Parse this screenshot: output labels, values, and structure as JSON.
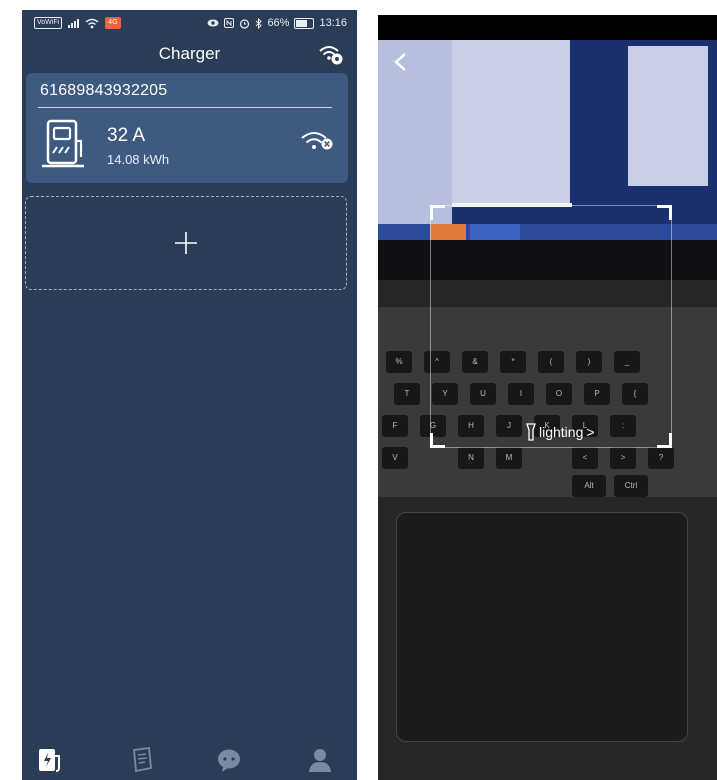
{
  "status_bar": {
    "left_chips": [
      "VoWiFi",
      "4G"
    ],
    "icons": [
      "eye-icon",
      "nfc-icon",
      "alarm-icon",
      "bluetooth-icon"
    ],
    "battery": "66%",
    "time": "13:16"
  },
  "header": {
    "title": "Charger",
    "action_icon": "wifi-settings-icon"
  },
  "charger_card": {
    "device_id": "61689843932205",
    "current": "32 A",
    "energy": "14.08 kWh",
    "icon": "charging-station-icon",
    "status_icon": "wifi-disconnected-icon"
  },
  "add_device": {
    "icon": "plus-icon"
  },
  "tab_bar": {
    "tabs": [
      {
        "name": "charger",
        "icon": "charging-station-icon",
        "active": true
      },
      {
        "name": "records",
        "icon": "document-icon",
        "active": false
      },
      {
        "name": "messages",
        "icon": "chat-icon",
        "active": false
      },
      {
        "name": "profile",
        "icon": "user-icon",
        "active": false
      }
    ]
  },
  "scanner": {
    "lighting_label": "lighting",
    "lighting_chevron": ">",
    "keys_row1": [
      "%",
      "^",
      "&",
      "*",
      "(",
      ")",
      "_"
    ],
    "keys_row2": [
      "T",
      "Y",
      "U",
      "I",
      "O",
      "P",
      "{"
    ],
    "keys_row3": [
      "F",
      "G",
      "H",
      "J",
      "K",
      "L",
      ":"
    ],
    "keys_row4": [
      "V",
      "N",
      "M",
      "<",
      ">",
      "?"
    ],
    "keys_row5": [
      "Alt",
      "Ctrl"
    ]
  },
  "colors": {
    "app_background": "#2b3c56",
    "card_background": "#3e5a80",
    "accent_white": "#ffffff"
  }
}
